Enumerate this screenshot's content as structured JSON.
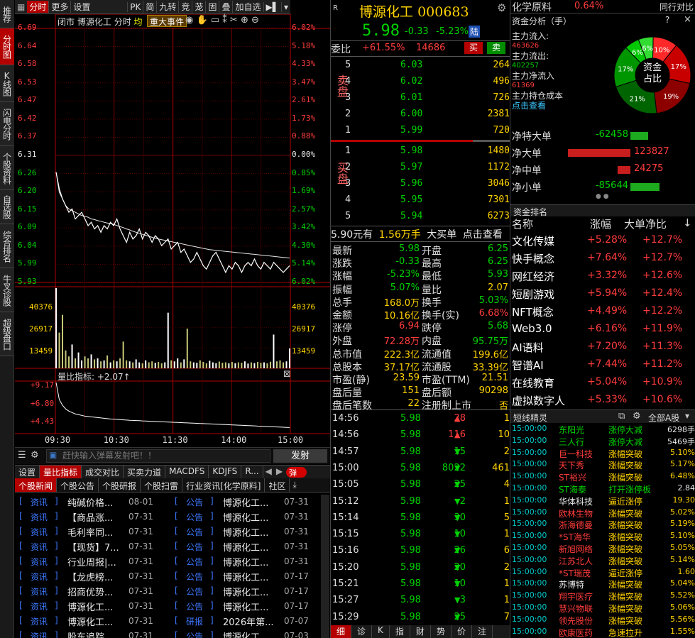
{
  "vertical_tabs": [
    "推荐",
    "分时图",
    "K线图",
    "闪电分时",
    "个股资料",
    "自选股",
    "综合排名",
    "牛叉诊股",
    "超级盘口"
  ],
  "toolbar": {
    "items": [
      "分时",
      "更多",
      "设置",
      "PK",
      "简",
      "九转",
      "竞",
      "茏",
      "固",
      "叠",
      "加自选"
    ]
  },
  "chart": {
    "header": [
      "闭市",
      "博源化工",
      "分时",
      "均"
    ],
    "event_button": "重大事件",
    "price_ticks": [
      "6.69",
      "6.64",
      "6.58",
      "6.53",
      "6.47",
      "6.42",
      "6.37",
      "6.31",
      "6.26",
      "6.20",
      "6.15",
      "6.09",
      "6.04",
      "5.99",
      "5.93"
    ],
    "pct_ticks": [
      "6.02%",
      "5.18%",
      "4.33%",
      "3.47%",
      "2.61%",
      "1.73%",
      "0.88%",
      "0.00%",
      "0.85%",
      "1.69%",
      "2.57%",
      "3.42%",
      "4.30%",
      "5.14%",
      "6.02%"
    ],
    "vol_ticks": [
      "40376",
      "26917",
      "13459"
    ],
    "ratio_label": "量比指标: +2.07↑",
    "ratio_ticks": [
      "+9.17",
      "+6.80",
      "+4.43"
    ],
    "time_ticks": [
      "09:30",
      "10:30",
      "11:30",
      "14:00",
      "15:00"
    ]
  },
  "chart_data": {
    "type": "line",
    "title": "博源化工 分时",
    "prev_close": 6.31,
    "ylim": [
      5.93,
      6.69
    ],
    "price": [
      6.26,
      6.21,
      6.18,
      6.16,
      6.14,
      6.15,
      6.12,
      6.13,
      6.14,
      6.12,
      6.1,
      6.11,
      6.09,
      6.1,
      6.08,
      6.1,
      6.09,
      6.11,
      6.1,
      6.12,
      6.09,
      6.07,
      6.05,
      6.08,
      6.06,
      6.07,
      6.09,
      6.06,
      6.08,
      6.07,
      6.05,
      6.07,
      6.06,
      6.04,
      6.05,
      6.06,
      6.03,
      6.04,
      6.05,
      6.02,
      6.03,
      6.01,
      5.99,
      6.0,
      6.02,
      6.0,
      5.98,
      5.97,
      5.99,
      6.01,
      6.02,
      6.0,
      5.98,
      5.96,
      5.98,
      5.97,
      5.99,
      5.98,
      5.96,
      5.98,
      5.99,
      5.98,
      6.0,
      5.98,
      5.97,
      5.99,
      5.98,
      5.97,
      5.99,
      5.98,
      5.97,
      5.96,
      5.97,
      5.98
    ],
    "avg": [
      6.26,
      6.2,
      6.18,
      6.16,
      6.15,
      6.145,
      6.14,
      6.135,
      6.13,
      6.128,
      6.125,
      6.12,
      6.118,
      6.115,
      6.113,
      6.11,
      6.108,
      6.106,
      6.104,
      6.1,
      6.097,
      6.094,
      6.09,
      6.087,
      6.083,
      6.08,
      6.077,
      6.074,
      6.071,
      6.068,
      6.065,
      6.062,
      6.06,
      6.058,
      6.056,
      6.054,
      6.052,
      6.05,
      6.048,
      6.046,
      6.044,
      6.042,
      6.04,
      6.038,
      6.036,
      6.034,
      6.032,
      6.03,
      6.028,
      6.027,
      6.026,
      6.025,
      6.024,
      6.023,
      6.022,
      6.021,
      6.02,
      6.019,
      6.018,
      6.017,
      6.016,
      6.015,
      6.014,
      6.013,
      6.012,
      6.011,
      6.01,
      6.009,
      6.008,
      6.007,
      6.006,
      6.005,
      6.004,
      6.003
    ],
    "volume": [
      40376,
      18000,
      26917,
      9000,
      6000,
      12000,
      5000,
      8000,
      4000,
      6000,
      5000,
      7000,
      4500,
      5000,
      3500,
      4000,
      6500,
      3000,
      4000,
      3500,
      5000,
      13459,
      4000,
      3500,
      3000,
      4500,
      3000,
      2500,
      4000,
      3000,
      3500,
      2800,
      3200,
      2500,
      3000,
      28000,
      4000,
      3500,
      5000,
      3000,
      4500,
      20000,
      3500,
      3000,
      2800,
      4000,
      3200,
      2500,
      3800,
      3000,
      2600,
      3400,
      2800,
      3000,
      2500,
      3200,
      2600,
      3000,
      2800,
      3500,
      2400,
      3000,
      2600,
      3200,
      2800,
      3000,
      2500,
      3300,
      17000,
      3500,
      4000,
      3000,
      3500,
      10000
    ],
    "volume_max": 40376,
    "ratio": [
      9.17,
      6.8,
      6.0,
      5.5,
      5.2,
      5.0,
      4.8,
      4.7,
      4.6,
      4.5,
      4.45,
      4.4,
      4.35,
      4.3,
      4.25,
      4.2,
      4.15,
      4.1,
      4.08,
      4.05,
      4.0,
      3.98,
      3.95,
      3.92,
      3.9,
      3.88,
      3.86,
      3.84,
      3.82,
      3.8,
      3.78,
      3.76,
      3.74,
      3.72,
      3.7,
      3.68,
      3.66,
      3.64,
      3.62,
      3.6,
      3.58,
      3.56,
      3.54,
      3.52,
      3.5,
      3.48,
      3.46,
      3.44,
      3.42,
      3.4,
      3.38,
      3.36,
      3.34,
      3.32,
      3.3,
      3.28,
      3.26,
      3.24,
      3.22,
      3.2,
      3.18,
      3.16,
      3.14,
      3.12,
      3.1,
      3.08,
      3.06,
      3.04,
      3.02,
      3.0,
      2.98,
      2.96,
      2.94,
      2.92
    ],
    "ratio_ylim": [
      2.07,
      9.17
    ],
    "x": [
      "09:30",
      "10:30",
      "11:30",
      "14:00",
      "15:00"
    ]
  },
  "danmu": {
    "placeholder": "赶快输入弹幕发射吧！！",
    "send_label": "发射",
    "toggle": "弹"
  },
  "bottom_tabs": [
    "设置",
    "量比指标",
    "成交对比",
    "买卖力道",
    "MACDFS",
    "KDJFS",
    "R..."
  ],
  "news_tabs": [
    "个股新闻",
    "个股公告",
    "个股研报",
    "个股扫雷",
    "行业资讯[化学原料]",
    "社区"
  ],
  "news_left": [
    {
      "tag": "资讯",
      "title": "纯碱价格...",
      "date": "08-01"
    },
    {
      "tag": "资讯",
      "title": "【商品涨...",
      "date": "07-31"
    },
    {
      "tag": "资讯",
      "title": "毛利率同...",
      "date": "07-31"
    },
    {
      "tag": "资讯",
      "title": "【现货】7...",
      "date": "07-31"
    },
    {
      "tag": "资讯",
      "title": "行业周报|...",
      "date": "07-31"
    },
    {
      "tag": "资讯",
      "title": "【龙虎榜...",
      "date": "07-31"
    },
    {
      "tag": "资讯",
      "title": "招商优势...",
      "date": "07-31"
    },
    {
      "tag": "资讯",
      "title": "博源化工...",
      "date": "07-31"
    },
    {
      "tag": "资讯",
      "title": "博源化工...",
      "date": "07-31"
    },
    {
      "tag": "资讯",
      "title": "股东追踪...",
      "date": "07-31"
    }
  ],
  "news_right": [
    {
      "tag": "公告",
      "title": "博源化工...",
      "date": "07-31"
    },
    {
      "tag": "公告",
      "title": "博源化工...",
      "date": "07-31"
    },
    {
      "tag": "公告",
      "title": "博源化工...",
      "date": "07-31"
    },
    {
      "tag": "公告",
      "title": "博源化工...",
      "date": "07-31"
    },
    {
      "tag": "公告",
      "title": "博源化工...",
      "date": "07-31"
    },
    {
      "tag": "公告",
      "title": "博源化工...",
      "date": "07-17"
    },
    {
      "tag": "公告",
      "title": "博源化工...",
      "date": "07-17"
    },
    {
      "tag": "公告",
      "title": "博源化工...",
      "date": "07-17"
    },
    {
      "tag": "研报",
      "title": "2026年第...",
      "date": "07-07"
    },
    {
      "tag": "公告",
      "title": "博源化工...",
      "date": "07-03"
    }
  ],
  "quote": {
    "name": "博源化工",
    "code": "000683",
    "price": "5.98",
    "change": "-0.33",
    "pct": "-5.23%",
    "market": "陆",
    "wei_label": "委比",
    "wei_ratio": "+61.55%",
    "wei_diff": "14686",
    "buy_btn": "买",
    "sell_btn": "卖",
    "sell_label": "卖盘",
    "buy_label": "买盘",
    "asks": [
      [
        "5",
        "6.03",
        "264"
      ],
      [
        "4",
        "6.02",
        "496"
      ],
      [
        "3",
        "6.01",
        "726"
      ],
      [
        "2",
        "6.00",
        "2381"
      ],
      [
        "1",
        "5.99",
        "720"
      ]
    ],
    "bids": [
      [
        "1",
        "5.98",
        "1480"
      ],
      [
        "2",
        "5.97",
        "1172"
      ],
      [
        "3",
        "5.96",
        "3046"
      ],
      [
        "4",
        "5.95",
        "7301"
      ],
      [
        "5",
        "5.94",
        "6273"
      ]
    ],
    "bigorder": {
      "price": "5.90元有",
      "vol": "1.56万手",
      "label": "大买单",
      "link": "点击查看"
    },
    "stats": [
      [
        "最新",
        "5.98",
        "开盘",
        "6.25"
      ],
      [
        "涨跌",
        "-0.33",
        "最高",
        "6.25"
      ],
      [
        "涨幅",
        "-5.23%",
        "最低",
        "5.93"
      ],
      [
        "振幅",
        "5.07%",
        "量比",
        "2.07"
      ],
      [
        "总手",
        "168.0万",
        "换手",
        "5.03%"
      ],
      [
        "金额",
        "10.16亿",
        "换手(实)",
        "6.68%"
      ],
      [
        "涨停",
        "6.94",
        "跌停",
        "5.68"
      ],
      [
        "外盘",
        "72.28万",
        "内盘",
        "95.75万"
      ],
      [
        "总市值",
        "222.3亿",
        "流通值",
        "199.6亿"
      ],
      [
        "总股本",
        "37.17亿",
        "流通股",
        "33.39亿"
      ],
      [
        "市盈(静)",
        "23.59",
        "市盈(TTM)",
        "21.51"
      ],
      [
        "盘后量",
        "151",
        "盘后额",
        "90298"
      ],
      [
        "盘后笔数",
        "22",
        "注册制上市",
        "否"
      ]
    ],
    "ticks": [
      [
        "14:56",
        "5.98",
        "28",
        "up",
        "1"
      ],
      [
        "14:56",
        "5.98",
        "116",
        "up",
        "10"
      ],
      [
        "14:57",
        "5.98",
        "15",
        "down",
        "2"
      ],
      [
        "15:00",
        "5.98",
        "8022",
        "down",
        "461"
      ],
      [
        "15:05",
        "5.98",
        "25",
        "down",
        "4"
      ],
      [
        "15:12",
        "5.98",
        "2",
        "down",
        "1"
      ],
      [
        "15:14",
        "5.98",
        "30",
        "down",
        "5"
      ],
      [
        "15:15",
        "5.98",
        "10",
        "down",
        "1"
      ],
      [
        "15:16",
        "5.98",
        "26",
        "down",
        "6"
      ],
      [
        "15:20",
        "5.98",
        "20",
        "down",
        "2"
      ],
      [
        "15:21",
        "5.98",
        "10",
        "down",
        "1"
      ],
      [
        "15:27",
        "5.98",
        "3",
        "down",
        "1"
      ],
      [
        "15:29",
        "5.98",
        "25",
        "down",
        "7"
      ]
    ],
    "bottom_tabs": [
      "细",
      "诊",
      "K",
      "指",
      "财",
      "势",
      "价",
      "注"
    ]
  },
  "sector": {
    "name": "化学原料",
    "pct": "0.64%",
    "compare": "同行对比"
  },
  "fund": {
    "title": "资金分析（手）",
    "help": "?",
    "close": "×",
    "in_label": "主力流入:",
    "in_val": "463626",
    "out_label": "主力流出:",
    "out_val": "402257",
    "net_label": "主力净流入",
    "net_val": "61369",
    "cost_label": "主力持仓成本",
    "cost_link": "点击查看",
    "pie_center": "资金占比",
    "pie": [
      10,
      17,
      19,
      21,
      17,
      6,
      6
    ],
    "pie_labels": [
      "10%",
      "17%",
      "19%",
      "21%",
      "17%",
      "6%",
      "6%"
    ],
    "flows": [
      [
        "净特大单",
        "-62458",
        "green",
        0.51
      ],
      [
        "净大单",
        "123827",
        "red",
        1.0
      ],
      [
        "净中单",
        "24275",
        "red",
        0.2
      ],
      [
        "净小单",
        "-85644",
        "green",
        0.69
      ]
    ]
  },
  "rank": {
    "title": "资金排名",
    "head": [
      "名称",
      "涨幅",
      "大单净比"
    ],
    "rows": [
      [
        "文化传媒",
        "+5.28%",
        "+12.7%"
      ],
      [
        "快手概念",
        "+7.64%",
        "+12.7%"
      ],
      [
        "网红经济",
        "+3.32%",
        "+12.6%"
      ],
      [
        "短剧游戏",
        "+5.94%",
        "+12.4%"
      ],
      [
        "NFT概念",
        "+4.49%",
        "+12.2%"
      ],
      [
        "Web3.0",
        "+6.16%",
        "+11.9%"
      ],
      [
        "AI语料",
        "+7.20%",
        "+11.3%"
      ],
      [
        "智谱AI",
        "+7.44%",
        "+11.2%"
      ],
      [
        "在线教育",
        "+5.04%",
        "+10.9%"
      ],
      [
        "虚拟数字人",
        "+5.33%",
        "+10.6%"
      ]
    ]
  },
  "sprite": {
    "title": "短线精灵",
    "filter": "全部A股",
    "rows": [
      [
        "15:00:00",
        "东阳光",
        "涨停大减",
        "6298手"
      ],
      [
        "15:00:00",
        "三人行",
        "涨停大减",
        "5469手"
      ],
      [
        "15:00:00",
        "巨一科技",
        "涨幅突破",
        "5.10%"
      ],
      [
        "15:00:00",
        "天下秀",
        "涨幅突破",
        "5.17%"
      ],
      [
        "15:00:00",
        "ST裕兴",
        "涨幅突破",
        "6.48%"
      ],
      [
        "15:00:00",
        "ST海泰",
        "打开涨停板",
        "2.84"
      ],
      [
        "15:00:00",
        "华体科技",
        "逼近涨停",
        "19.30"
      ],
      [
        "15:00:00",
        "欧林生物",
        "涨幅突破",
        "5.02%"
      ],
      [
        "15:00:00",
        "浙海德曼",
        "涨幅突破",
        "5.19%"
      ],
      [
        "15:00:00",
        "*ST海华",
        "涨幅突破",
        "5.10%"
      ],
      [
        "15:00:00",
        "新旭网络",
        "涨幅突破",
        "5.05%"
      ],
      [
        "15:00:00",
        "江苏北人",
        "涨幅突破",
        "5.14%"
      ],
      [
        "15:00:00",
        "*ST瑞茂",
        "逼近涨停",
        "1.60"
      ],
      [
        "15:00:00",
        "苏博特",
        "涨幅突破",
        "5.04%"
      ],
      [
        "15:00:00",
        "翔宇医疗",
        "涨幅突破",
        "5.52%"
      ],
      [
        "15:00:00",
        "慧兴物联",
        "涨幅突破",
        "5.06%"
      ],
      [
        "15:00:00",
        "领先股份",
        "涨幅突破",
        "5.56%"
      ],
      [
        "15:00:00",
        "欧康医药",
        "急速拉升",
        "1.55%"
      ]
    ]
  },
  "colors": {
    "up": "#ff3c3c",
    "down": "#00d200",
    "accent": "#b40000",
    "line": "#ffffff",
    "avg": "#ffff00",
    "vol": "#c8c878"
  }
}
